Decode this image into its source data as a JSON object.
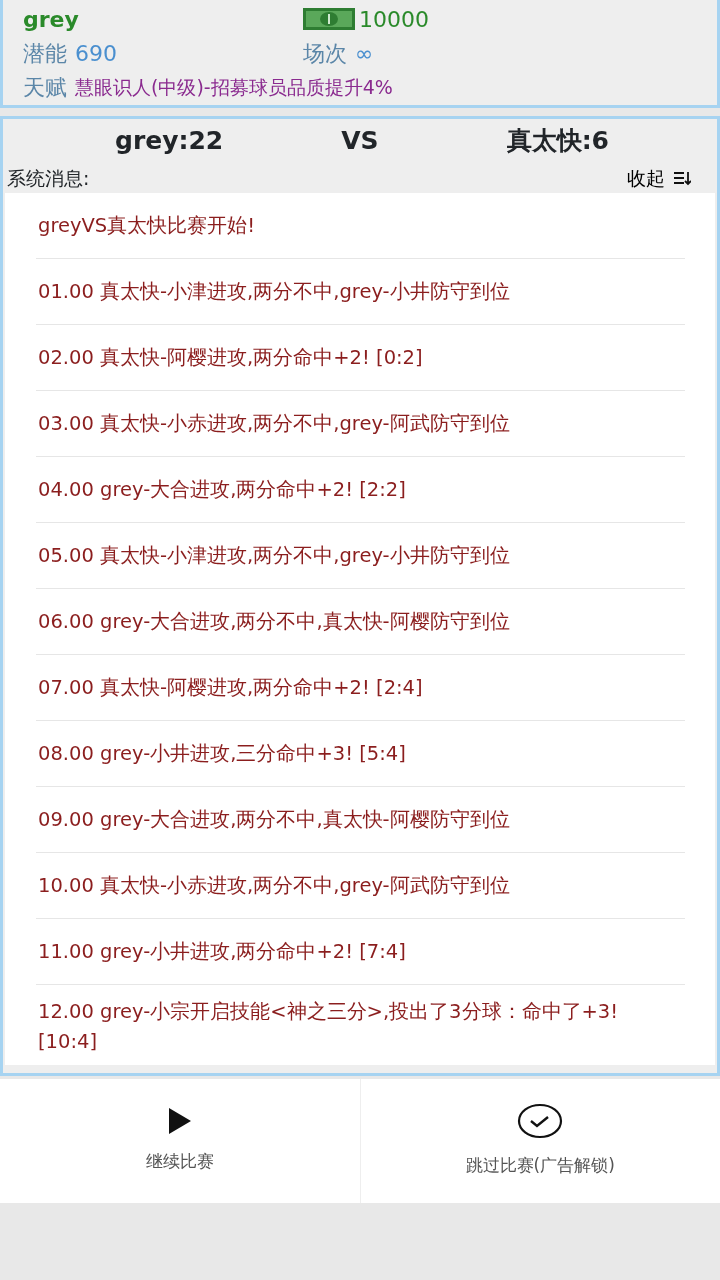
{
  "player": {
    "name": "grey",
    "money": "10000",
    "potential_label": "潜能",
    "potential": "690",
    "matches_label": "场次",
    "matches": "∞",
    "talent_label": "天赋",
    "talent": "慧眼识人(中级)-招募球员品质提升4%"
  },
  "scoreboard": {
    "home": "grey:22",
    "vs": "VS",
    "away": "真太快:6"
  },
  "messages_header": {
    "title": "系统消息:",
    "collapse": "收起"
  },
  "messages": [
    "greyVS真太快比赛开始!",
    "01.00 真太快-小津进攻,两分不中,grey-小井防守到位",
    "02.00 真太快-阿樱进攻,两分命中+2! [0:2]",
    "03.00 真太快-小赤进攻,两分不中,grey-阿武防守到位",
    "04.00 grey-大合进攻,两分命中+2! [2:2]",
    "05.00 真太快-小津进攻,两分不中,grey-小井防守到位",
    "06.00 grey-大合进攻,两分不中,真太快-阿樱防守到位",
    "07.00 真太快-阿樱进攻,两分命中+2! [2:4]",
    "08.00 grey-小井进攻,三分命中+3! [5:4]",
    "09.00 grey-大合进攻,两分不中,真太快-阿樱防守到位",
    "10.00 真太快-小赤进攻,两分不中,grey-阿武防守到位",
    "11.00 grey-小井进攻,两分命中+2! [7:4]",
    "12.00 grey-小宗开启技能<神之三分>,投出了3分球：命中了+3! [10:4]"
  ],
  "actions": [
    {
      "kind": "play",
      "label": "继续比赛"
    },
    {
      "kind": "check",
      "label": "跳过比赛(广告解锁)"
    }
  ]
}
